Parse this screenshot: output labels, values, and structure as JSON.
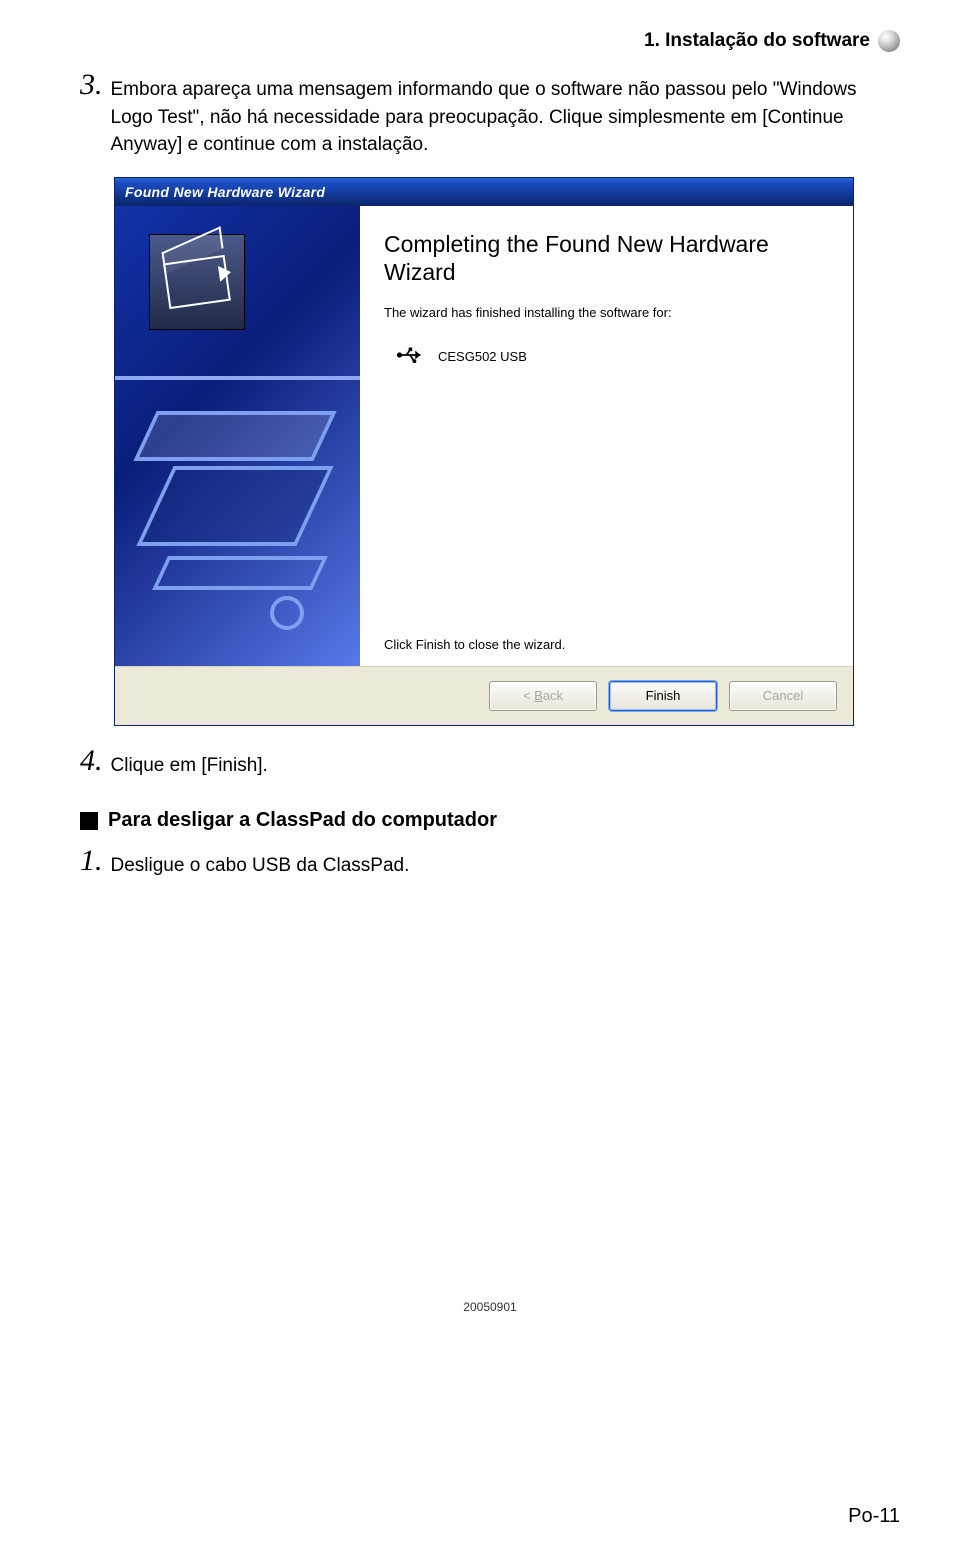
{
  "header": {
    "title": "1. Instalação do software"
  },
  "step3": {
    "num": "3.",
    "text": "Embora apareça uma mensagem informando que o software não passou pelo \"Windows Logo Test\", não há necessidade para preocupação. Clique simplesmente em [Continue Anyway] e continue com a instalação."
  },
  "wizard": {
    "titlebar": "Found New Hardware Wizard",
    "heading": "Completing the Found New Hardware Wizard",
    "subtext": "The wizard has finished installing the software for:",
    "device_name": "CESG502 USB",
    "close_hint": "Click Finish to close the wizard.",
    "buttons": {
      "back_prefix": "< ",
      "back_u": "B",
      "back_suffix": "ack",
      "finish": "Finish",
      "cancel": "Cancel"
    }
  },
  "step4": {
    "num": "4.",
    "text": "Clique em [Finish]."
  },
  "section": {
    "title": "Para desligar a ClassPad do computador"
  },
  "step1b": {
    "num": "1.",
    "text": "Desligue o cabo USB da ClassPad."
  },
  "footer": {
    "date": "20050901",
    "pagenum": "Po-11"
  }
}
